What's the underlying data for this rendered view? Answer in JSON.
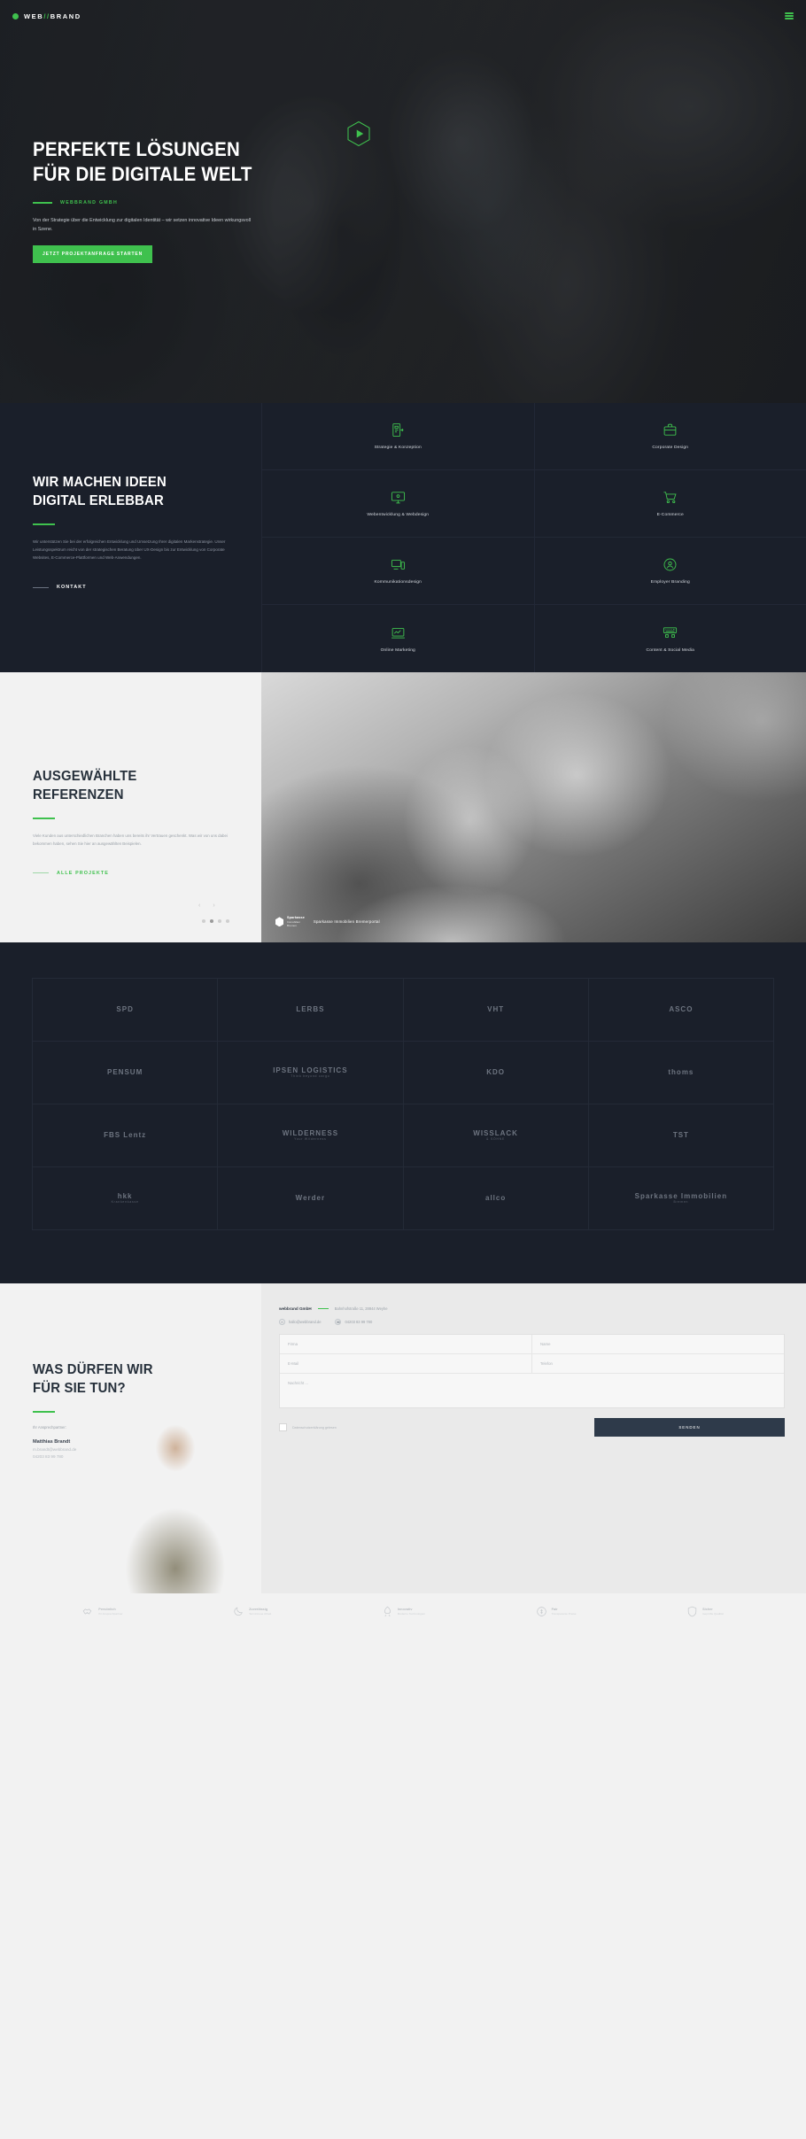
{
  "brand": {
    "logo_prefix": "WEB",
    "logo_separator": "//",
    "logo_suffix": "BRAND",
    "accent_color": "#3fc14e",
    "dark_color": "#1a1f2a"
  },
  "hero": {
    "title_line1": "PERFEKTE LÖSUNGEN",
    "title_line2": "FÜR DIE DIGITALE WELT",
    "eyebrow": "WEBBRAND GMBH",
    "subtitle": "Von der Strategie über die Entwicklung zur digitalen Identität – wir setzen innovative Ideen wirkungsvoll in Szene.",
    "cta_label": "JETZT PROJEKTANFRAGE STARTEN",
    "play_icon": "play-hexagon-icon",
    "menu_icon": "hamburger-menu-icon"
  },
  "services": {
    "title_line1": "WIR MACHEN IDEEN",
    "title_line2": "DIGITAL ERLEBBAR",
    "body": "Wir unterstützen Sie bei der erfolgreichen Entwicklung und Umsetzung Ihrer digitalen Markenstrategie. Unser Leistungsspektrum reicht von der strategischen Beratung über UX-Design bis zur Entwicklung von Corporate Websites, E-Commerce-Plattformen und Web-Anwendungen.",
    "link_label": "KONTAKT",
    "items": [
      {
        "label": "Strategie & Konzeption",
        "icon": "strategy-mobile-icon"
      },
      {
        "label": "Corporate Design",
        "icon": "briefcase-design-icon"
      },
      {
        "label": "Webentwicklung & Webdesign",
        "icon": "monitor-code-icon"
      },
      {
        "label": "E-Commerce",
        "icon": "shopping-cart-icon"
      },
      {
        "label": "Kommunikationsdesign",
        "icon": "devices-responsive-icon"
      },
      {
        "label": "Employer Branding",
        "icon": "user-circle-icon"
      },
      {
        "label": "Online Marketing",
        "icon": "chart-laptop-icon"
      },
      {
        "label": "Content & Social Media",
        "icon": "keyboard-social-icon"
      }
    ]
  },
  "references": {
    "title_line1": "AUSGEWÄHLTE",
    "title_line2": "REFERENZEN",
    "body": "Viele Kunden aus unterschiedlichen Branchen haben uns bereits ihr Vertrauen geschenkt. Was wir von uns dabei bekommen haben, sehen Sie hier an ausgewählten Beispielen.",
    "link_label": "ALLE PROJEKTE",
    "slide": {
      "logo_title": "Sparkasse",
      "logo_sub": "Immobilien",
      "logo_sub2": "Bremen",
      "caption": "Sparkasse Immobilien Bremerportal"
    },
    "prev_icon": "chevron-left-icon",
    "next_icon": "chevron-right-icon",
    "dots": [
      false,
      true,
      false,
      false
    ]
  },
  "clients": {
    "items": [
      {
        "name": "SPD",
        "sub": ""
      },
      {
        "name": "LERBS",
        "sub": ""
      },
      {
        "name": "VHT",
        "sub": ""
      },
      {
        "name": "ASCO",
        "sub": ""
      },
      {
        "name": "PENSUM",
        "sub": ""
      },
      {
        "name": "IPSEN LOGISTICS",
        "sub": "Think beyond cargo"
      },
      {
        "name": "KDO",
        "sub": ""
      },
      {
        "name": "thoms",
        "sub": ""
      },
      {
        "name": "FBS Lentz",
        "sub": ""
      },
      {
        "name": "WILDERNESS",
        "sub": "Your Wilderness"
      },
      {
        "name": "WISSLACK",
        "sub": "& SÖHNE"
      },
      {
        "name": "TST",
        "sub": ""
      },
      {
        "name": "hkk",
        "sub": "Krankenkasse"
      },
      {
        "name": "Werder",
        "sub": ""
      },
      {
        "name": "allco",
        "sub": ""
      },
      {
        "name": "Sparkasse Immobilien",
        "sub": "Bremen"
      }
    ]
  },
  "contact": {
    "title_line1": "WAS DÜRFEN WIR",
    "title_line2": "FÜR SIE TUN?",
    "person_label": "Ihr Ansprechpartner:",
    "person_name": "Matthias Brandt",
    "person_email": "m.brandt@webbrand.de",
    "person_phone": "04203 83 99 780",
    "form": {
      "company": "webbrand GmbH",
      "address": "Bahnhofstraße 11, 28844 Weyhe",
      "email": "hallo@webbrand.de",
      "phone": "04203 83 99 780",
      "email_icon": "envelope-icon",
      "phone_icon": "phone-icon",
      "fields": {
        "firma": "Firma",
        "name": "Name",
        "email": "E-Mail",
        "telefon": "Telefon",
        "nachricht": "Nachricht ..."
      },
      "privacy_label": "Datenschutzerklärung gelesen",
      "submit_label": "Senden"
    }
  },
  "footer": {
    "items": [
      {
        "title": "Persönlich",
        "sub": "Ihr Ansprechpartner",
        "icon": "handshake-icon"
      },
      {
        "title": "Zuverlässig",
        "sub": "Termintreue Arbeit",
        "icon": "moon-icon"
      },
      {
        "title": "Innovativ",
        "sub": "Moderne Technologien",
        "icon": "rocket-icon"
      },
      {
        "title": "Fair",
        "sub": "Transparente Preise",
        "icon": "coin-icon"
      },
      {
        "title": "Sicher",
        "sub": "Geprüfte Qualität",
        "icon": "shield-icon"
      }
    ]
  }
}
